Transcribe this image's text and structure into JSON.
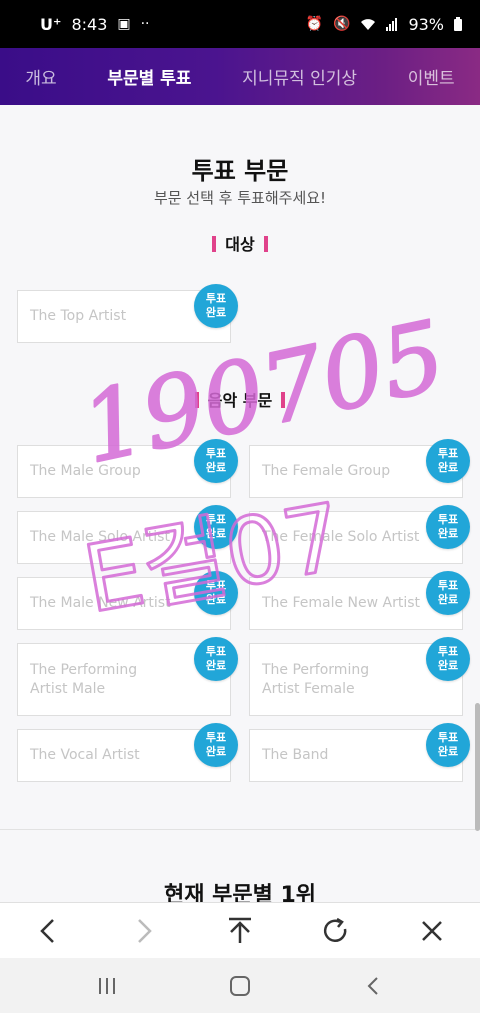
{
  "status_bar": {
    "carrier": "U⁺",
    "time": "8:43",
    "battery": "93%"
  },
  "tabs": [
    {
      "label": "개요",
      "active": false
    },
    {
      "label": "부문별 투표",
      "active": true
    },
    {
      "label": "지니뮤직 인기상",
      "active": false
    },
    {
      "label": "이벤트",
      "active": false
    }
  ],
  "vote": {
    "title": "투표 부문",
    "subtitle": "부문 선택 후 투표해주세요!",
    "badge_label_line1": "투표",
    "badge_label_line2": "완료",
    "grand_section": {
      "heading": "대상",
      "cards": [
        {
          "line1": "The Top Artist",
          "line2": ""
        }
      ]
    },
    "music_section": {
      "heading": "음악 부문",
      "cards": [
        {
          "line1": "The Male Group",
          "line2": ""
        },
        {
          "line1": "The Female Group",
          "line2": ""
        },
        {
          "line1": "The Male Solo Artist",
          "line2": ""
        },
        {
          "line1": "The Female Solo Artist",
          "line2": ""
        },
        {
          "line1": "The Male New Artist",
          "line2": ""
        },
        {
          "line1": "The Female New Artist",
          "line2": ""
        },
        {
          "line1": "The Performing",
          "line2": "Artist Male"
        },
        {
          "line1": "The Performing",
          "line2": "Artist Female"
        },
        {
          "line1": "The Vocal Artist",
          "line2": ""
        },
        {
          "line1": "The Band",
          "line2": ""
        }
      ]
    },
    "current_leaders_title": "현재 부문별 1위"
  },
  "handwriting": {
    "line1": "190705",
    "line2": "E걸07",
    "color": "#d46ad6"
  },
  "browser_toolbar": {
    "buttons": [
      "back-icon",
      "forward-icon",
      "scroll-top-icon",
      "refresh-icon",
      "close-icon"
    ]
  },
  "system_nav": {
    "buttons": [
      "recent-apps-icon",
      "home-icon",
      "back-icon"
    ]
  },
  "colors": {
    "badge": "#21a6d8",
    "section_bar": "#e0428b",
    "tab_gradient_start": "#3a0d88",
    "tab_gradient_end": "#8a2a84"
  }
}
